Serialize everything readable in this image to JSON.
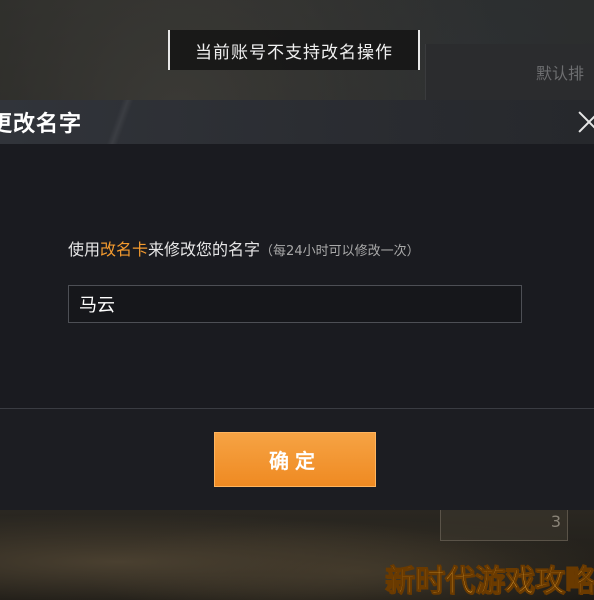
{
  "toast": {
    "text": "当前账号不支持改名操作"
  },
  "background": {
    "right_panel_text": "默认排",
    "card_number": "3"
  },
  "dialog": {
    "title": "更改名字",
    "prompt_prefix": "使用",
    "prompt_highlight": "改名卡",
    "prompt_suffix": "来修改您的名字",
    "prompt_hint": "（每24小时可以修改一次）",
    "name_value": "马云",
    "confirm_label": "确定"
  },
  "watermark": {
    "text": "新时代游戏攻略"
  },
  "colors": {
    "accent": "#f39a2e",
    "button": "#ef8a22"
  }
}
